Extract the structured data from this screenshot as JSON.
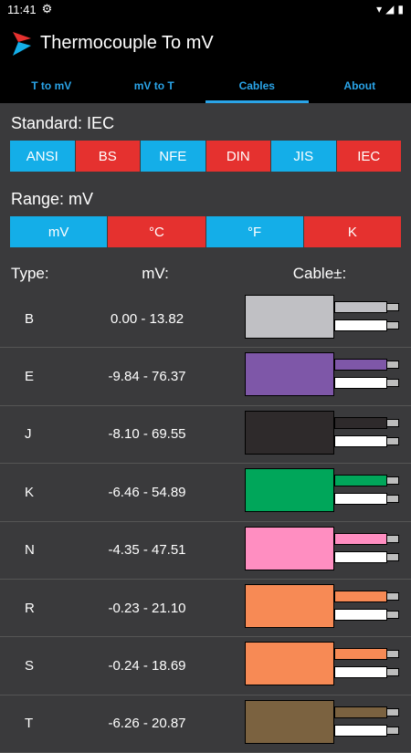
{
  "status": {
    "time": "11:41"
  },
  "app": {
    "title": "Thermocouple To mV"
  },
  "tabs": [
    {
      "label": "T to mV"
    },
    {
      "label": "mV to T"
    },
    {
      "label": "Cables"
    },
    {
      "label": "About"
    }
  ],
  "standard": {
    "label": "Standard: IEC",
    "options": [
      "ANSI",
      "BS",
      "NFE",
      "DIN",
      "JIS",
      "IEC"
    ]
  },
  "range": {
    "label": "Range: mV",
    "options": [
      "mV",
      "°C",
      "°F",
      "K"
    ]
  },
  "table": {
    "headers": {
      "type": "Type:",
      "mv": "mV:",
      "cable": "Cable±:"
    },
    "rows": [
      {
        "type": "B",
        "range": "0.00 - 13.82",
        "color": "#c0c0c4",
        "wire": "#c0c0c4"
      },
      {
        "type": "E",
        "range": "-9.84 - 76.37",
        "color": "#7e57a8",
        "wire": "#7e57a8"
      },
      {
        "type": "J",
        "range": "-8.10 - 69.55",
        "color": "#2e2a2b",
        "wire": "#2e2a2b"
      },
      {
        "type": "K",
        "range": "-6.46 - 54.89",
        "color": "#00a65a",
        "wire": "#00a65a"
      },
      {
        "type": "N",
        "range": "-4.35 - 47.51",
        "color": "#ff8ec1",
        "wire": "#ff8ec1"
      },
      {
        "type": "R",
        "range": "-0.23 - 21.10",
        "color": "#f78a55",
        "wire": "#f78a55"
      },
      {
        "type": "S",
        "range": "-0.24 - 18.69",
        "color": "#f78a55",
        "wire": "#f78a55"
      },
      {
        "type": "T",
        "range": "-6.26 - 20.87",
        "color": "#7b6240",
        "wire": "#7b6240"
      }
    ]
  }
}
